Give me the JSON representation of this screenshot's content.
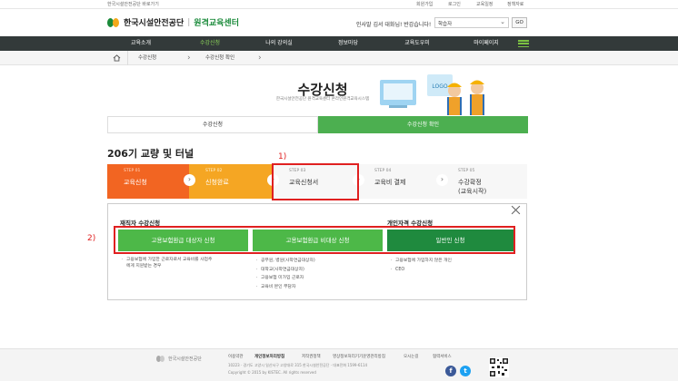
{
  "topbar": {
    "shortcut": "한국시설안전공단 바로가기",
    "links": [
      "회원가입",
      "로그인",
      "교육일정",
      "정책자료"
    ]
  },
  "header": {
    "org_name": "한국시설안전공단",
    "center_name": "원격교육센터",
    "greeting": "인사말 김서 대화님! 반갑습니다!",
    "search_value": "학습자",
    "go_label": "GO"
  },
  "nav": {
    "items": [
      "교육소개",
      "수강신청",
      "나의 강의실",
      "정보마당",
      "교육도우미",
      "마이페이지"
    ],
    "active_index": 1
  },
  "breadcrumb": [
    "수강신청",
    "수강신청 확인"
  ],
  "hero": {
    "title": "수강신청",
    "subtitle": "한국시설안전공단 원격교육센터 온라인원격교육시스템"
  },
  "tabs": [
    "수강신청",
    "수강신청 확인"
  ],
  "section_title": "206기 교량 및 터널",
  "steps": [
    {
      "num": "STEP 01",
      "label": "교육신청"
    },
    {
      "num": "STEP 02",
      "label": "신청완료"
    },
    {
      "num": "STEP 03",
      "label": "교육신청서"
    },
    {
      "num": "STEP 04",
      "label": "교육비 결제"
    },
    {
      "num": "STEP 05",
      "label": "수강확정",
      "label2": "(교육시작)"
    }
  ],
  "annotations": {
    "a1": "1)",
    "a2": "2)"
  },
  "panel": {
    "group1_title": "재직자 수강신청",
    "group2_title": "개인자격 수강신청",
    "btn_insured": "고용보험환급 대상자 신청",
    "btn_noninsured": "고용보험환급 비대상 신청",
    "btn_general": "일반인 신청",
    "col1": [
      "고용보험에 가입한 근로자로서 교육비를 사업주",
      "에게 지원받는 경우"
    ],
    "col2": [
      "공무원, 병원(사학연금대상자)",
      "대학교(사학연금대상자)",
      "고용보험 미가입 근로자",
      "교육비 본인 부담자"
    ],
    "col3": [
      "고용보험에 가입하지 않은 개인",
      "CEO"
    ]
  },
  "footer": {
    "org_name": "한국시설안전공단",
    "links": [
      "이용약관",
      "개인정보처리방침",
      "저작권정책",
      "영상정보처리기기운영관리방침",
      "오시는길",
      "협력서비스"
    ],
    "info": "10223 · 경기도 고양시 일산서구 고양대로 315 한국시설안전공단 · 대표전화 1599-6114",
    "copyright": "Copyright © 2015 by KISTEC. All rights reserved"
  },
  "colors": {
    "accent": "#4caf50",
    "nav_bg": "#333a3a",
    "annotation": "#e02020",
    "step_orange": "#f5a623"
  }
}
